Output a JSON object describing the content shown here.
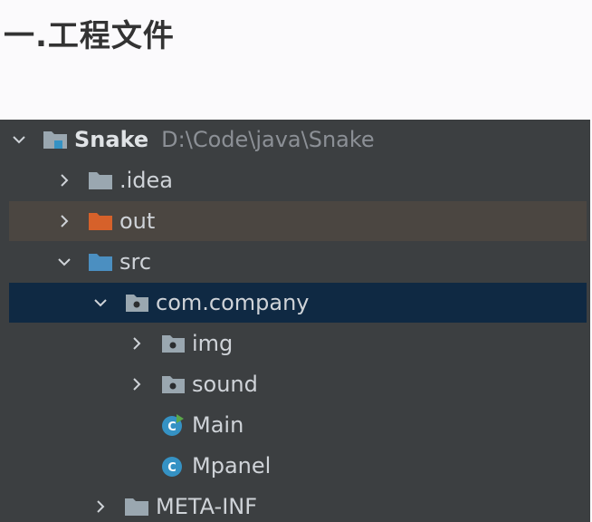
{
  "heading": "一.工程文件",
  "colors": {
    "panel_bg": "#3c3f41",
    "folder_gray": "#9aa7b0",
    "folder_out": "#d6612a",
    "folder_src": "#4b8fc1",
    "package": "#9aa7b0",
    "class_badge": "#3592c4",
    "run_marker": "#5aa84a",
    "selected_row": "#0f2943",
    "out_row": "#4b4641"
  },
  "tree": {
    "project": {
      "name": "Snake",
      "path": "D:\\Code\\java\\Snake",
      "expanded": true,
      "icon": "project-folder-icon"
    },
    "items": [
      {
        "label": ".idea",
        "expanded": false,
        "icon": "folder-icon",
        "depth": 1
      },
      {
        "label": "out",
        "expanded": false,
        "icon": "excluded-folder-icon",
        "depth": 1
      },
      {
        "label": "src",
        "expanded": true,
        "icon": "source-folder-icon",
        "depth": 1
      },
      {
        "label": "com.company",
        "expanded": true,
        "icon": "package-icon",
        "depth": 2,
        "selected": true
      },
      {
        "label": "img",
        "expanded": false,
        "icon": "package-icon",
        "depth": 3
      },
      {
        "label": "sound",
        "expanded": false,
        "icon": "package-icon",
        "depth": 3
      },
      {
        "label": "Main",
        "icon": "runnable-class-icon",
        "depth": 3
      },
      {
        "label": "Mpanel",
        "icon": "class-icon",
        "depth": 3
      },
      {
        "label": "META-INF",
        "expanded": false,
        "icon": "folder-icon",
        "depth": 2
      }
    ]
  }
}
